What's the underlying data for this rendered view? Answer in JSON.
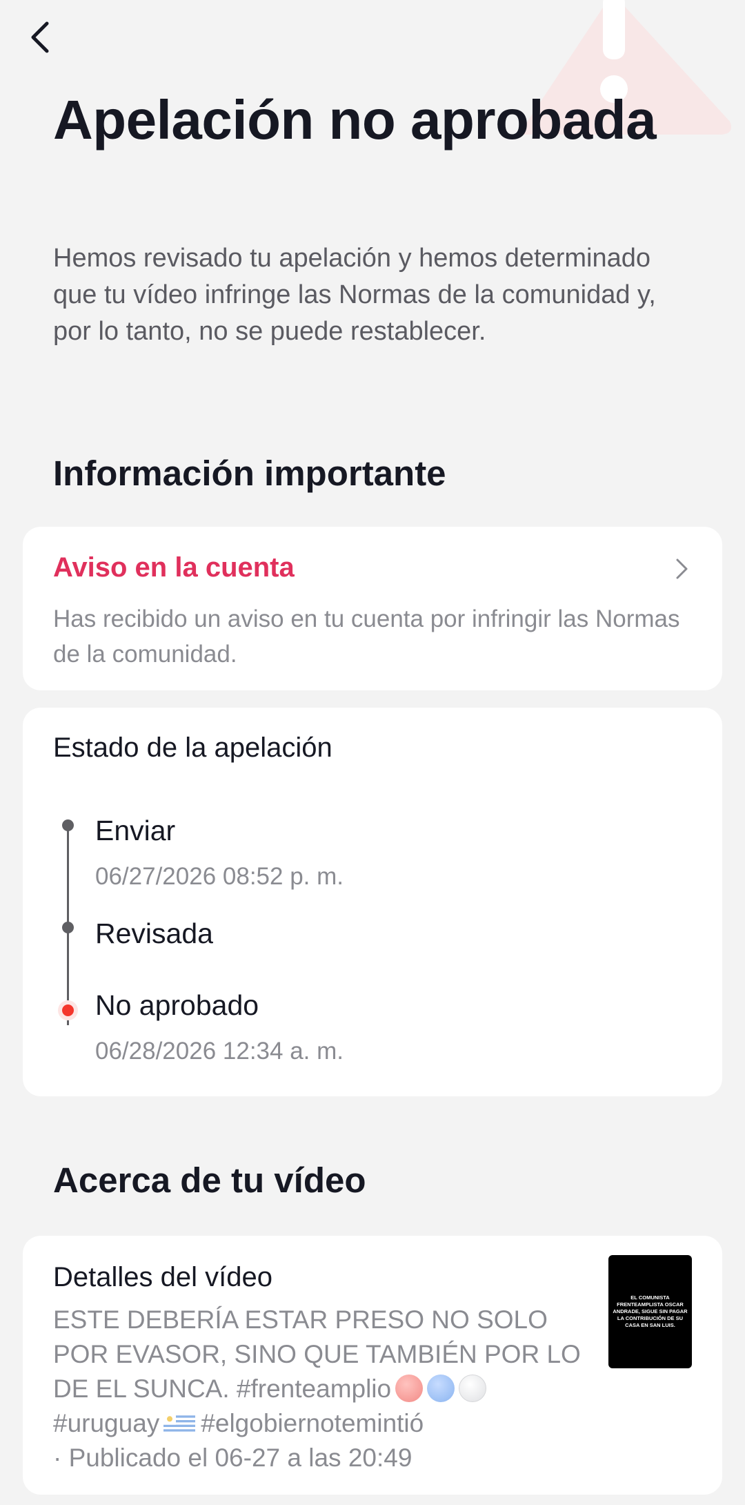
{
  "header": {
    "back_icon": "chevron-left-icon",
    "watermark_icon": "warning-triangle-icon"
  },
  "page": {
    "title": "Apelación no aprobada",
    "subtitle": "Hemos revisado tu apelación y hemos determinado que tu vídeo infringe las Normas de la comunidad y, por lo tanto, no se puede restablecer."
  },
  "important_info": {
    "heading": "Información importante",
    "notice": {
      "title": "Aviso en la cuenta",
      "description": "Has recibido un aviso en tu cuenta por infringir las Normas de la comunidad.",
      "title_color": "#e0305c",
      "chevron_icon": "chevron-right-icon"
    }
  },
  "appeal_status": {
    "title": "Estado de la apelación",
    "steps": [
      {
        "label": "Enviar",
        "date": "06/27/2026 08:52 p. m."
      },
      {
        "label": "Revisada",
        "date": ""
      },
      {
        "label": "No aprobado",
        "date": "06/28/2026 12:34 a. m.",
        "active": true
      }
    ],
    "active_color": "#f4362c"
  },
  "about_video": {
    "heading": "Acerca de tu vídeo",
    "details_title": "Detalles del vídeo",
    "description_text": "ESTE DEBERÍA ESTAR PRESO NO SOLO POR EVASOR, SINO QUE TAMBIÉN POR LO DE EL SUNCA. #frenteamplio",
    "description_hashtags": "#uruguay",
    "description_hashtag_2": "#elgobiernotemintió",
    "published": "· Publicado el 06-27 a las 20:49",
    "thumbnail_text": "EL COMUNISTA FRENTEAMPLISTA OSCAR ANDRADE, SIGUE SIN PAGAR LA CONTRIBUCIÓN DE SU CASA EN SAN LUIS."
  }
}
